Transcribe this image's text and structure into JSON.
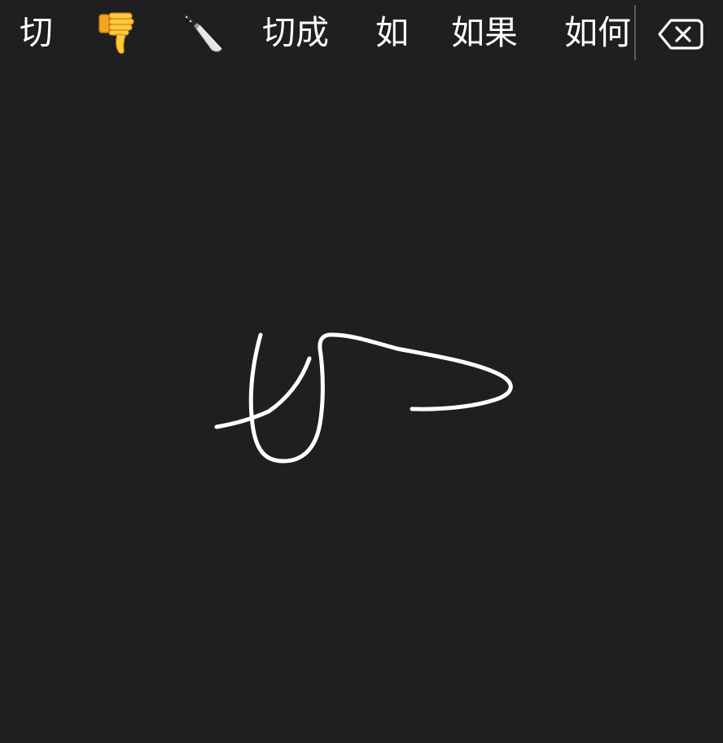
{
  "candidates": {
    "first": "切",
    "emoji_thumbs_down": "thumbs-down-emoji",
    "emoji_knife": "kitchen-knife-emoji",
    "third": "切成",
    "fourth": "如",
    "fifth": "如果",
    "sixth": "如何"
  },
  "delete_key": {
    "icon": "delete-backspace-icon"
  },
  "colors": {
    "background": "#1f1e21",
    "text": "#ffffff",
    "stroke": "#ffffff",
    "separator": "#5d5c60"
  }
}
